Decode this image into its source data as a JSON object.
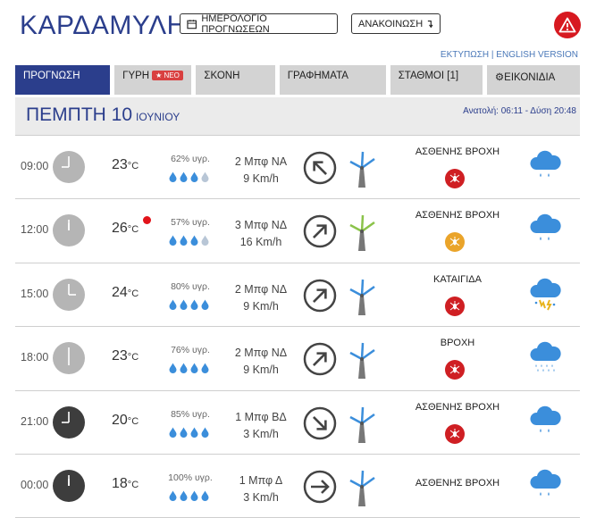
{
  "header": {
    "title": "ΚΑΡΔΑΜΥΛΗ",
    "calendar_button": "ΗΜΕΡΟΛΟΓΙΟ ΠΡΟΓΝΩΣΕΩΝ",
    "announcement_button": "ΑΝΑΚΟΙΝΩΣΗ",
    "print_link": "ΕΚΤΥΠΩΣΗ",
    "separator": "|",
    "english_link": "ENGLISH VERSION",
    "alert_icon": "warning-triangle-icon",
    "alert_color": "#d71920"
  },
  "tabs": [
    {
      "label": "ΠΡΟΓΝΩΣΗ",
      "active": true
    },
    {
      "label": "ΓΥΡΗ",
      "badge": "ΝΕΟ"
    },
    {
      "label": "ΣΚΟΝΗ"
    },
    {
      "label": "ΓΡΑΦΗΜΑΤΑ"
    },
    {
      "label": "ΣΤΑΘΜΟΙ [1]"
    },
    {
      "label": "ΕΙΚΟΝΙΔΙΑ",
      "icon": "gear-icon"
    }
  ],
  "day": {
    "name": "ΠΕΜΠΤΗ 10",
    "month": "ΙΟΥΝΙΟΥ",
    "sun": "Ανατολή: 06:11  - Δύση 20:48"
  },
  "colors": {
    "brand": "#2b3e8c",
    "drop": "#3b8edb",
    "tab_bg": "#d3d3d3",
    "warn_red": "#cf1f23",
    "warn_orange": "#eaa42a"
  },
  "rows": [
    {
      "time": "09:00",
      "temp": "23",
      "unit": "°C",
      "humidity": "62% υγρ.",
      "drops_filled": 3,
      "wind_bf": "2 Μπφ ΝΑ",
      "wind_kmh": "9 Km/h",
      "wind_dir": "NW-arrow",
      "condition": "ΑΣΘΕΝΗΣ ΒΡΟΧΗ",
      "badge": "red",
      "weather_icon": "rain-cloud-icon",
      "night": false
    },
    {
      "time": "12:00",
      "temp": "26",
      "unit": "°C",
      "hot": true,
      "humidity": "57% υγρ.",
      "drops_filled": 3,
      "wind_bf": "3 Μπφ ΝΔ",
      "wind_kmh": "16 Km/h",
      "wind_dir": "NE-arrow",
      "condition": "ΑΣΘΕΝΗΣ ΒΡΟΧΗ",
      "badge": "orange",
      "weather_icon": "rain-cloud-icon",
      "night": false
    },
    {
      "time": "15:00",
      "temp": "24",
      "unit": "°C",
      "humidity": "80% υγρ.",
      "drops_filled": 4,
      "wind_bf": "2 Μπφ ΝΔ",
      "wind_kmh": "9 Km/h",
      "wind_dir": "NE-arrow",
      "condition": "ΚΑΤΑΙΓΙΔΑ",
      "badge": "red",
      "weather_icon": "thunderstorm-icon",
      "night": false
    },
    {
      "time": "18:00",
      "temp": "23",
      "unit": "°C",
      "humidity": "76% υγρ.",
      "drops_filled": 4,
      "wind_bf": "2 Μπφ ΝΔ",
      "wind_kmh": "9 Km/h",
      "wind_dir": "NE-arrow",
      "condition": "ΒΡΟΧΗ",
      "badge": "red",
      "weather_icon": "heavy-rain-cloud-icon",
      "night": false
    },
    {
      "time": "21:00",
      "temp": "20",
      "unit": "°C",
      "humidity": "85% υγρ.",
      "drops_filled": 4,
      "wind_bf": "1 Μπφ ΒΔ",
      "wind_kmh": "3 Km/h",
      "wind_dir": "SE-arrow",
      "condition": "ΑΣΘΕΝΗΣ ΒΡΟΧΗ",
      "badge": "red",
      "weather_icon": "rain-cloud-icon",
      "night": true
    },
    {
      "time": "00:00",
      "temp": "18",
      "unit": "°C",
      "humidity": "100% υγρ.",
      "drops_filled": 4,
      "wind_bf": "1 Μπφ Δ",
      "wind_kmh": "3 Km/h",
      "wind_dir": "E-arrow",
      "condition": "ΑΣΘΕΝΗΣ ΒΡΟΧΗ",
      "badge": "none",
      "weather_icon": "rain-cloud-icon",
      "night": true
    }
  ]
}
